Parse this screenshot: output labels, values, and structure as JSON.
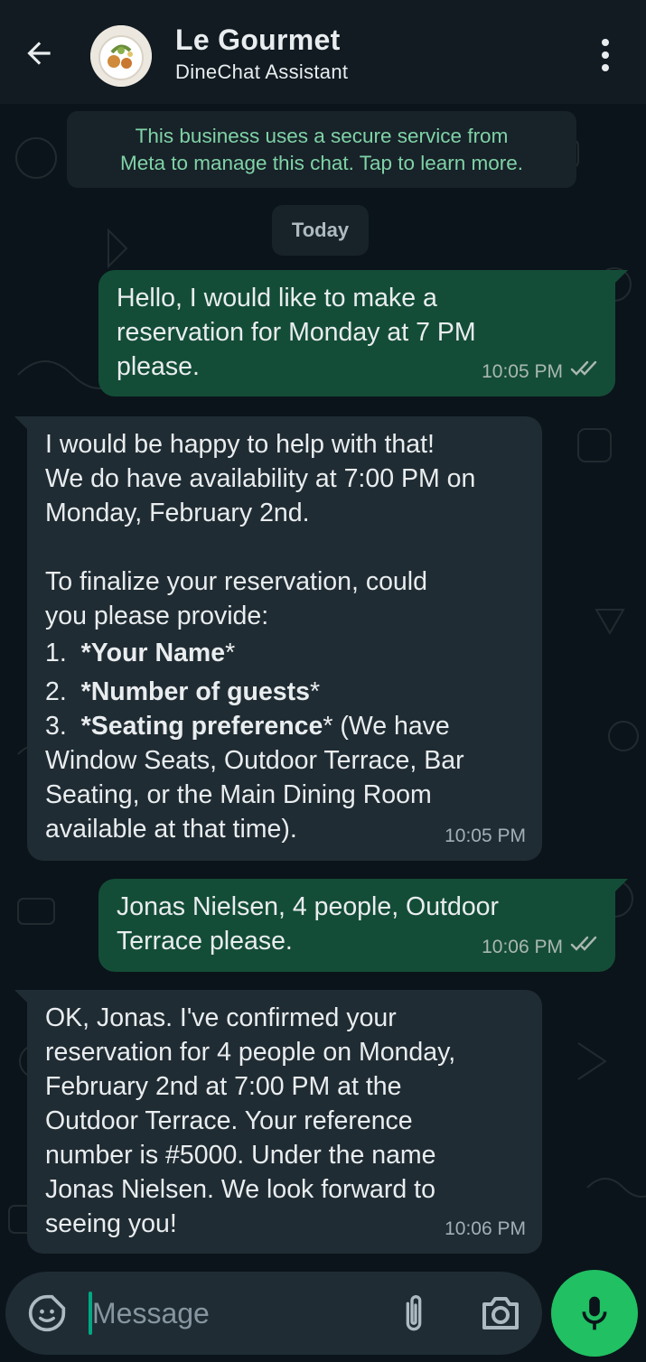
{
  "header": {
    "title": "Le Gourmet",
    "subtitle": "DineChat Assistant"
  },
  "notice": {
    "line1": "This business uses a secure service from",
    "line2": "Meta to manage this chat. Tap to learn more."
  },
  "date_divider": "Today",
  "messages": [
    {
      "direction": "outgoing",
      "lines": [
        "Hello, I would like to make a",
        "reservation for Monday at 7 PM",
        "please."
      ],
      "time": "10:05 PM",
      "status": "read"
    },
    {
      "direction": "incoming",
      "lines": [
        "I would be happy to help with that!",
        "We do have availability at 7:00 PM on",
        "Monday, February 2nd.",
        "",
        "To finalize your reservation, could",
        "you please provide:"
      ],
      "list": [
        {
          "num": "1.",
          "pre": "*",
          "bold": "Your Name",
          "post": "*"
        },
        {
          "num": "2.",
          "pre": "*",
          "bold": "Number of guests",
          "post": "*"
        },
        {
          "num": "3.",
          "pre": "*",
          "bold": "Seating preference",
          "post": "* (We have"
        }
      ],
      "tail_lines": [
        "Window Seats, Outdoor Terrace, Bar",
        "Seating, or the Main Dining Room",
        "available at that time)."
      ],
      "time": "10:05 PM"
    },
    {
      "direction": "outgoing",
      "lines": [
        "Jonas Nielsen, 4 people,  Outdoor",
        "Terrace please."
      ],
      "time": "10:06 PM",
      "status": "read"
    },
    {
      "direction": "incoming",
      "lines": [
        "OK, Jonas. I've confirmed your",
        "reservation for 4 people on Monday,",
        "February 2nd at 7:00 PM at the",
        "Outdoor Terrace. Your reference",
        "number is #5000. Under the name",
        "Jonas Nielsen. We look forward to",
        "seeing you!"
      ],
      "time": "10:06 PM"
    }
  ],
  "composer": {
    "placeholder": "Message"
  },
  "colors": {
    "background": "#0b141a",
    "outgoing_bubble": "#144d37",
    "incoming_bubble": "#202c33",
    "accent_green": "#21c063",
    "notice_text": "#7fd3a6"
  }
}
